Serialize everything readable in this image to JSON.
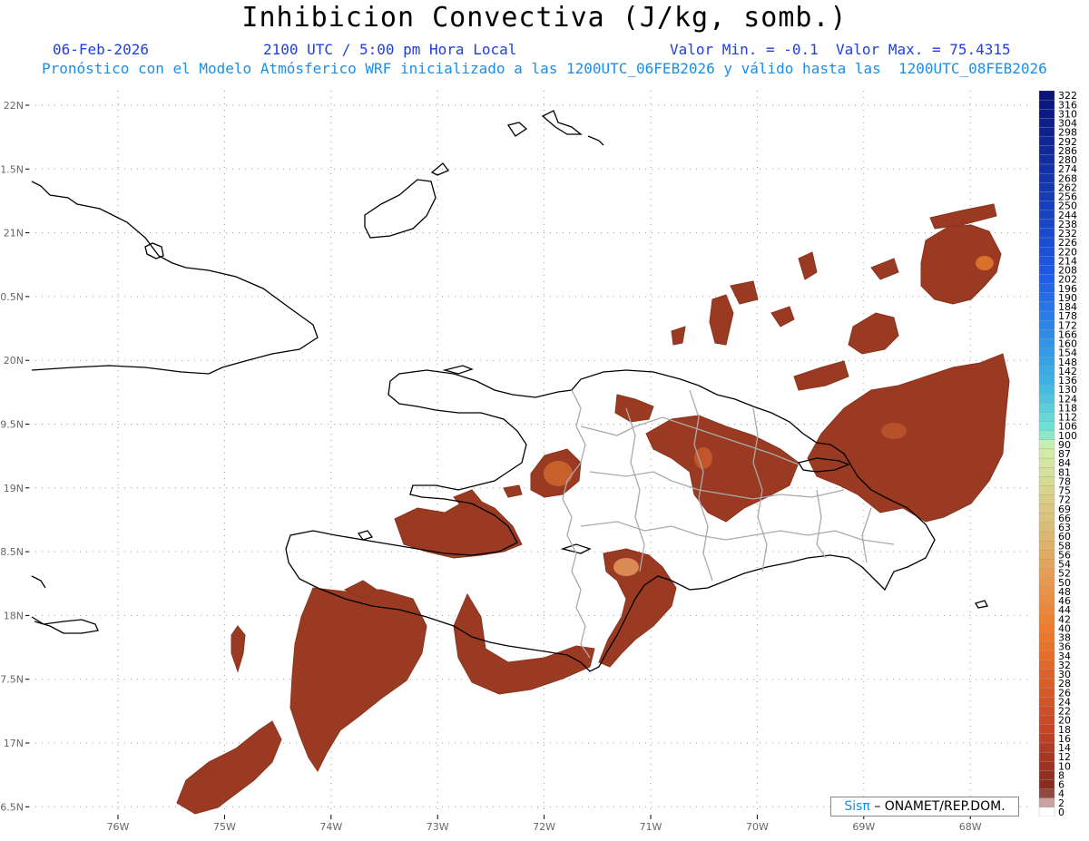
{
  "header": {
    "title": "Inhibicion Convectiva (J/kg, somb.)",
    "date": "06-Feb-2026",
    "time": "2100 UTC / 5:00 pm Hora Local",
    "minmax": "Valor Min. = -0.1  Valor Max. = 75.4315",
    "forecast": "Pronóstico con el Modelo Atmósferico WRF inicializado a las 1200UTC_06FEB2026 y válido hasta las  1200UTC_08FEB2026"
  },
  "map": {
    "lat_labels": [
      "22N",
      "1.5N",
      "21N",
      "0.5N",
      "20N",
      "9.5N",
      "19N",
      "8.5N",
      "18N",
      "7.5N",
      "17N",
      "6.5N"
    ],
    "lon_labels": [
      "76W",
      "75W",
      "74W",
      "73W",
      "72W",
      "71W",
      "70W",
      "69W",
      "68W"
    ]
  },
  "colorbar": {
    "labels": [
      "322",
      "316",
      "310",
      "304",
      "298",
      "292",
      "286",
      "280",
      "274",
      "268",
      "262",
      "256",
      "250",
      "244",
      "238",
      "232",
      "226",
      "220",
      "214",
      "208",
      "202",
      "196",
      "190",
      "184",
      "178",
      "172",
      "166",
      "160",
      "154",
      "148",
      "142",
      "136",
      "130",
      "124",
      "118",
      "112",
      "106",
      "100",
      "90",
      "87",
      "84",
      "81",
      "78",
      "75",
      "72",
      "69",
      "66",
      "63",
      "60",
      "58",
      "56",
      "54",
      "52",
      "50",
      "48",
      "46",
      "44",
      "42",
      "40",
      "38",
      "36",
      "34",
      "32",
      "30",
      "28",
      "26",
      "24",
      "22",
      "20",
      "18",
      "16",
      "14",
      "12",
      "10",
      "8",
      "6",
      "4",
      "2",
      "0"
    ]
  },
  "credit": {
    "brand": "Sisπ",
    "text": "– ONAMET/REP.DOM."
  },
  "colors": {
    "shading": "#9a3a22",
    "shading_light": "#c8602e",
    "coast": "#000000",
    "borders": "#aaaaaa"
  }
}
